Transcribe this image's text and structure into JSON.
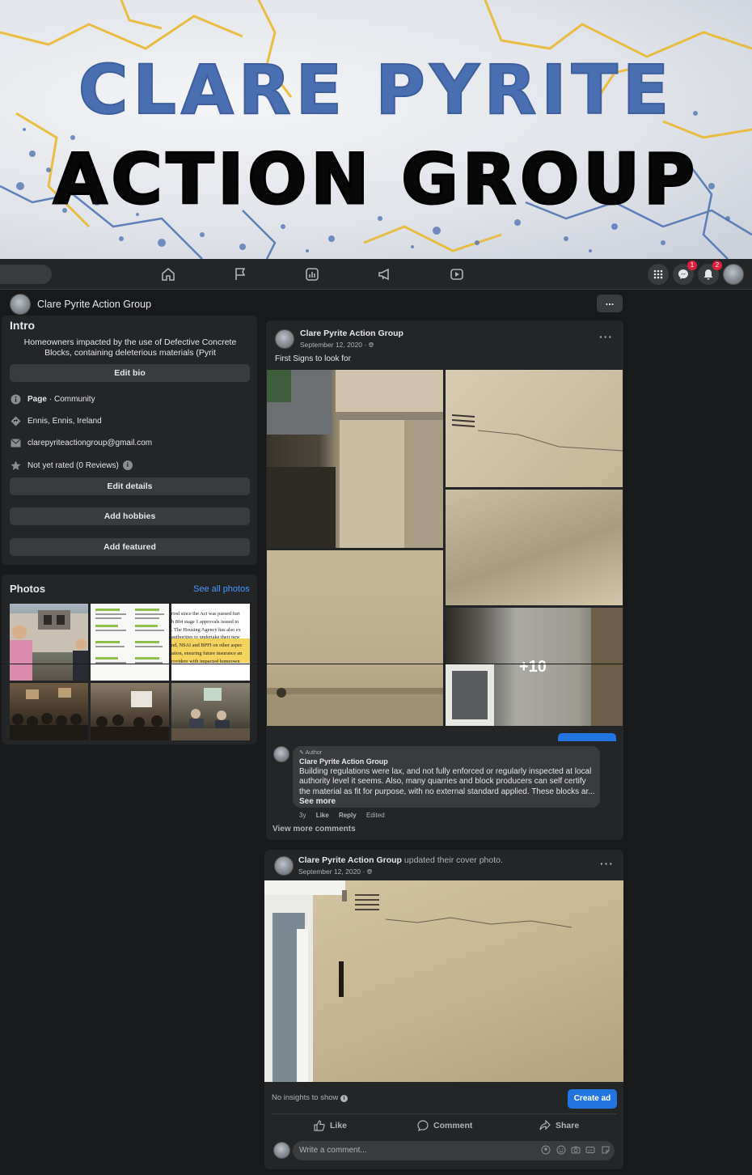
{
  "cover": {
    "line1": "CLARE PYRITE",
    "line2": "ACTION GROUP"
  },
  "navbar": {
    "icons": [
      "home-icon",
      "flag-icon",
      "insights-icon",
      "megaphone-icon",
      "video-icon"
    ],
    "right_icons": [
      "grid-menu-icon",
      "messenger-icon",
      "notifications-icon",
      "profile-avatar"
    ],
    "messenger_badge": "1",
    "notifications_badge": "2"
  },
  "page": {
    "name": "Clare Pyrite Action Group",
    "more_label": "..."
  },
  "intro": {
    "title": "Intro",
    "description": "Homeowners impacted by the use of Defective Concrete Blocks, containing deleterious materials (Pyrit",
    "edit_bio": "Edit bio",
    "rows": [
      {
        "icon": "info-icon",
        "bold": "Page",
        "text": "· Community"
      },
      {
        "icon": "location-icon",
        "bold": "",
        "text": "Ennis, Ennis, Ireland"
      },
      {
        "icon": "email-icon",
        "bold": "",
        "text": "clarepyriteactiongroup@gmail.com"
      },
      {
        "icon": "star-icon",
        "bold": "",
        "text": "Not yet rated (0 Reviews)"
      }
    ],
    "rating_info": "i",
    "edit_details": "Edit details",
    "add_hobbies": "Add hobbies",
    "add_featured": "Add featured"
  },
  "photos": {
    "title": "Photos",
    "see_all": "See all photos",
    "doc_lines": [
      "riod since the Act was passed furt",
      "h 804 stage 1 approvals issued to",
      ". The Housing Agency has also ex",
      "authorities to undertake their new",
      "nd, NSAI and BPFI on other aspec",
      "ation, ensuring future insurance an",
      "roviders with impacted homeown"
    ]
  },
  "post1": {
    "author": "Clare Pyrite Action Group",
    "date": "September 12, 2020 ·",
    "text": "First Signs to look for",
    "more_count": "+10",
    "dots": "···",
    "comment": {
      "badge": "Author",
      "author": "Clare Pyrite Action Group",
      "text": "Building regulations were lax, and not fully enforced or regularly inspected at local authority level it seems. Also, many quarries and block producers can self certify the material as fit for purpose, with no external standard applied. These blocks ar...",
      "see_more": "See more",
      "time": "3y",
      "like": "Like",
      "reply": "Reply",
      "edited": "Edited"
    },
    "view_more": "View more comments"
  },
  "post2": {
    "author": "Clare Pyrite Action Group",
    "action": "updated their cover photo.",
    "date": "September 12, 2020 ·",
    "dots": "···",
    "insights": "No insights to show",
    "create_ad": "Create ad",
    "like": "Like",
    "comment": "Comment",
    "share": "Share",
    "write_placeholder": "Write a comment..."
  }
}
